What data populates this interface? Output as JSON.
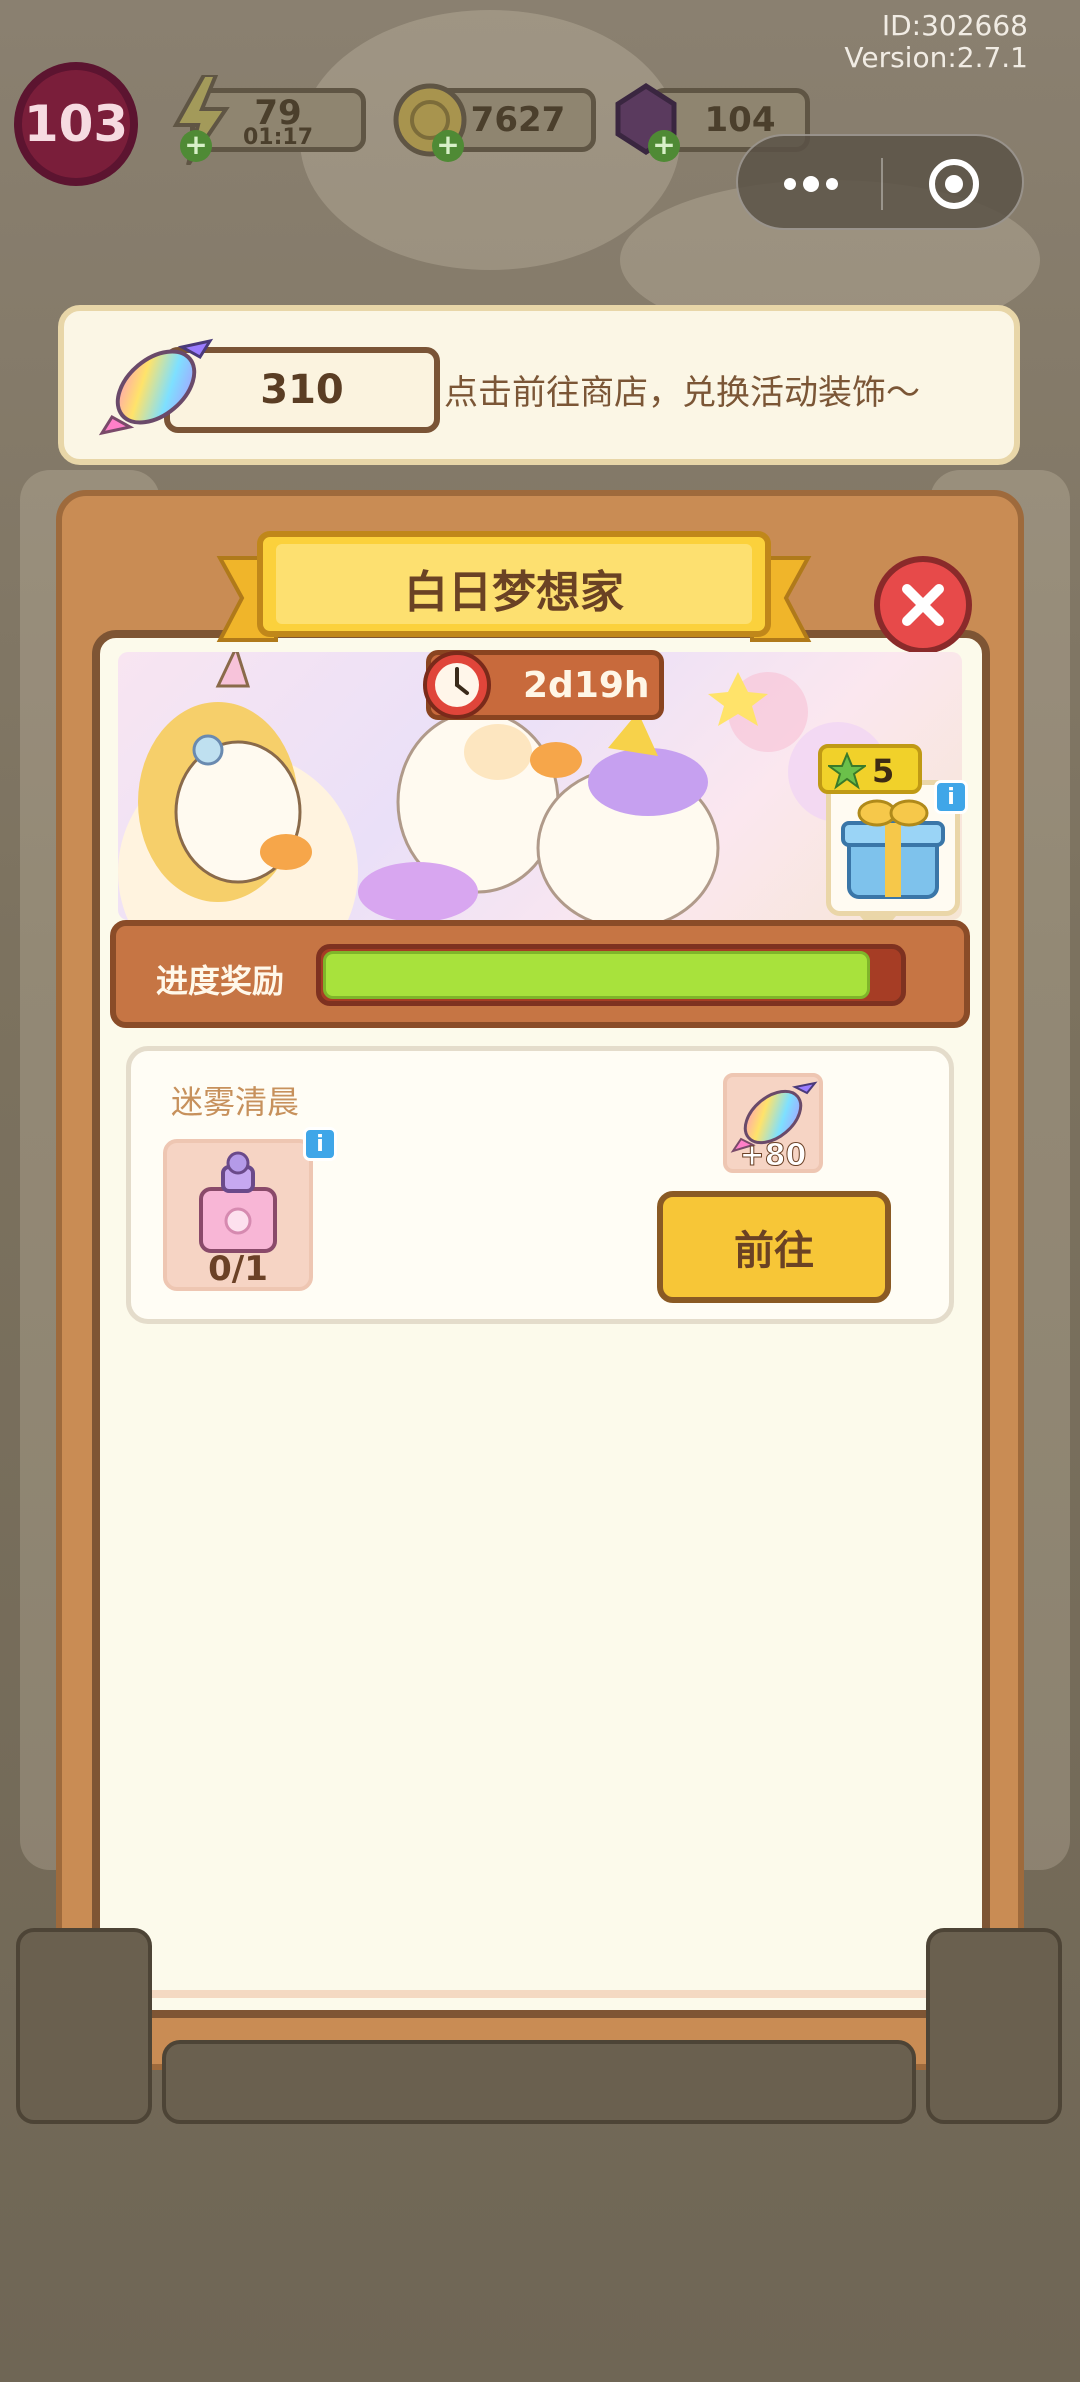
{
  "build": {
    "id": "ID:302668",
    "version": "Version:2.7.1"
  },
  "hud": {
    "level": "103",
    "energy": "79",
    "energy_timer": "01:17",
    "coins": "7627",
    "gems": "104"
  },
  "banner": {
    "candy_count": "310",
    "hint": "点击前往商店，兑换活动装饰～"
  },
  "event": {
    "title": "白日梦想家",
    "timer": "2d19h",
    "reward_stars": "5",
    "progress_label": "进度奖励",
    "progress_fraction": 0.95,
    "task": {
      "title": "迷雾清晨",
      "progress": "0/1",
      "reward": "+80",
      "button": "前往"
    }
  },
  "icons": {
    "info": "i",
    "close": "close-icon"
  },
  "colors": {
    "panel": "#c98c54",
    "progress_fill": "#a8e23c",
    "go_button": "#f7c637",
    "close_button": "#e74a4a"
  }
}
